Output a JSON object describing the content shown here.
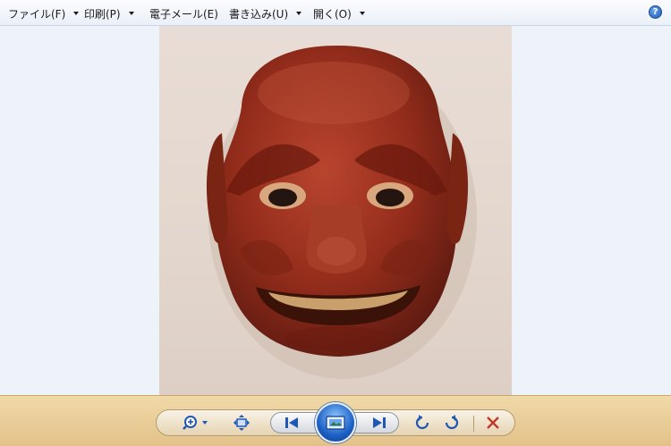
{
  "menu": {
    "file": "ファイル(F)",
    "print": "印刷(P)",
    "email": "電子メール(E)",
    "burn": "書き込み(U)",
    "open": "開く(O)"
  },
  "help_icon_label": "?",
  "photo": {
    "subject": "red carved wooden mask"
  },
  "toolbar": {
    "icons": [
      "zoom-icon",
      "fit-window-icon",
      "previous-icon",
      "slideshow-icon",
      "next-icon",
      "rotate-counterclockwise-icon",
      "rotate-clockwise-icon",
      "delete-icon"
    ]
  },
  "colors": {
    "menubar": "#eef2f9",
    "toolbar": "#e8c98f",
    "accent": "#1f57b4",
    "delete": "#c0392b"
  }
}
